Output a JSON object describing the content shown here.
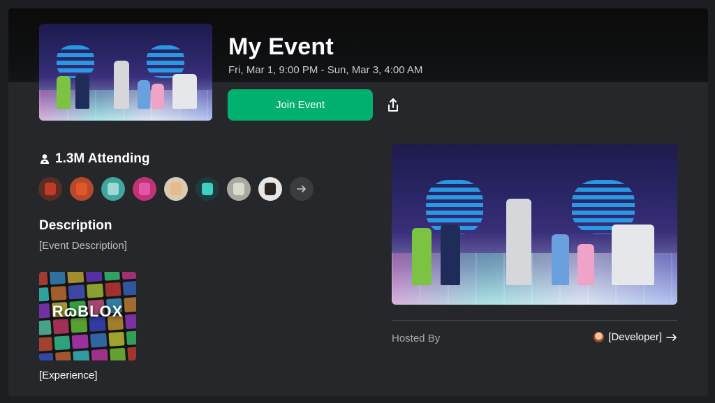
{
  "event": {
    "title": "My Event",
    "date_range": "Fri, Mar 1, 9:00 PM - Sun, Mar 3, 4:00 AM",
    "join_label": "Join Event"
  },
  "attendance": {
    "label": "1.3M Attending",
    "avatar_count": 8
  },
  "description": {
    "heading": "Description",
    "text": "[Event Description]"
  },
  "experience": {
    "logo_text": "RɷBLOX",
    "name": "[Experience]"
  },
  "host": {
    "label": "Hosted By",
    "name": "[Developer]"
  },
  "colors": {
    "accent_green": "#00b06f",
    "background": "#26272b",
    "header": "#0f1011"
  },
  "icons": {
    "share": "share-icon",
    "person": "person-icon",
    "more": "arrow-right-icon",
    "host_arrow": "arrow-right-icon"
  }
}
